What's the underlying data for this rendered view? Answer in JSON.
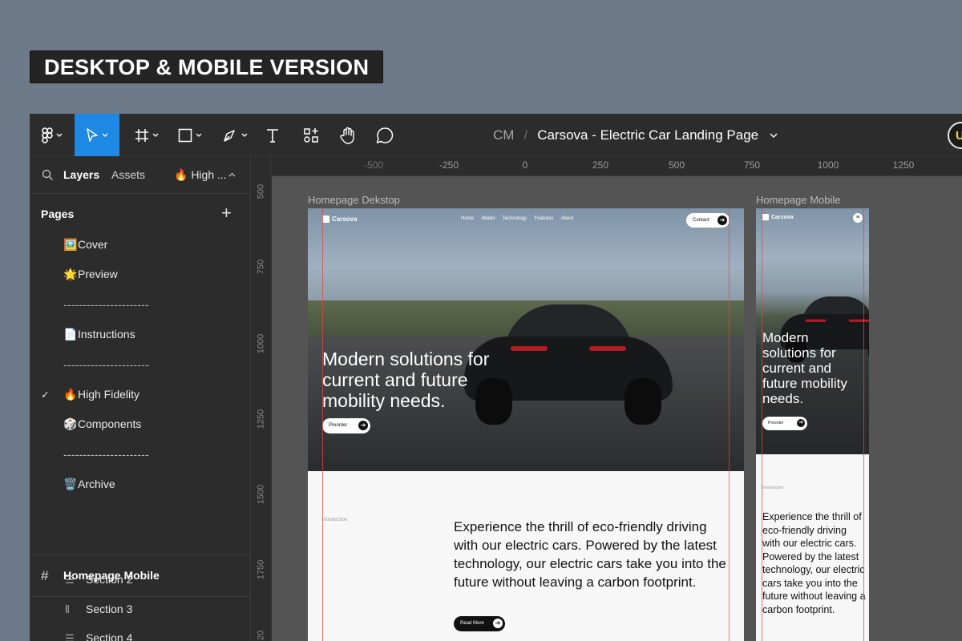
{
  "banner": {
    "text": "DESKTOP & MOBILE VERSION"
  },
  "toolbar": {
    "team": "CM",
    "separator": "/",
    "file_title": "Carsova - Electric Car Landing Page",
    "avatar_initial": "U",
    "tools": [
      "figma-menu",
      "move",
      "frame",
      "shape",
      "pen",
      "text",
      "resources",
      "hand",
      "comment"
    ]
  },
  "sidebar": {
    "tabs": {
      "layers": "Layers",
      "assets": "Assets",
      "page_select": "🔥 High ..."
    },
    "pages_header": "Pages",
    "pages": [
      {
        "icon": "🖼️",
        "label": "Cover"
      },
      {
        "icon": "🌟",
        "label": "Preview"
      },
      {
        "icon": "",
        "label": "----------------------"
      },
      {
        "icon": "📄",
        "label": "Instructions"
      },
      {
        "icon": "",
        "label": "----------------------"
      },
      {
        "icon": "🔥",
        "label": "High Fidelity"
      },
      {
        "icon": "🎲",
        "label": "Components"
      },
      {
        "icon": "",
        "label": "----------------------"
      },
      {
        "icon": "🗑️",
        "label": "Archive"
      }
    ],
    "current_frame": "Homepage Mobile",
    "layers": [
      "Section 2",
      "Section 3",
      "Section 4"
    ]
  },
  "rulers": {
    "horizontal": [
      "-500",
      "-250",
      "0",
      "250",
      "500",
      "750",
      "1000",
      "1250"
    ],
    "vertical": [
      "500",
      "750",
      "1000",
      "1250",
      "1500",
      "1750",
      "20"
    ]
  },
  "canvas": {
    "desktop_frame_label": "Homepage Dekstop",
    "mobile_frame_label": "Homepage Mobile"
  },
  "site": {
    "brand": "Carsova",
    "nav": [
      "Home",
      "Model",
      "Technology",
      "Features",
      "About"
    ],
    "contact": "Contact",
    "headline": "Modern solutions for current and future mobility needs.",
    "preorder": "Preorder",
    "intro_label": "Introduction",
    "intro_text": "Experience the thrill of eco-friendly driving with our electric cars. Powered by the latest technology, our electric cars take you into the future without leaving a carbon footprint.",
    "read_more": "Read More",
    "arrow": "➔"
  }
}
